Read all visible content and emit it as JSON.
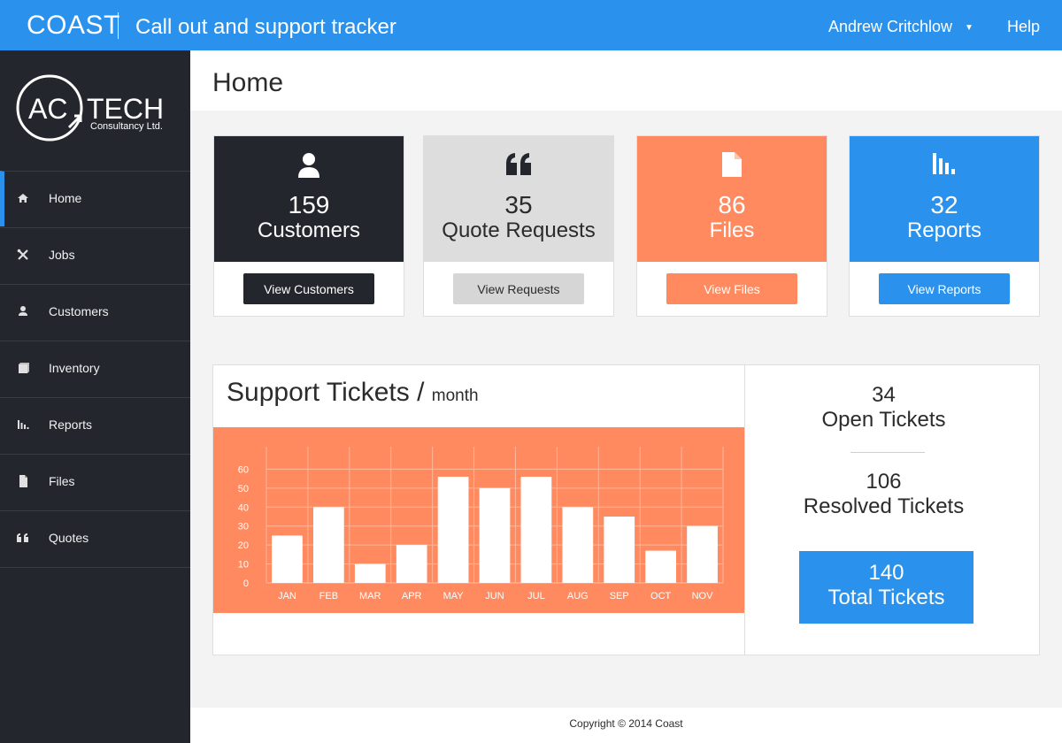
{
  "topbar": {
    "brand": "COAST",
    "tagline": "Call out and support tracker",
    "user_name": "Andrew Critchlow",
    "help_label": "Help"
  },
  "logo": {
    "line1": "AC",
    "line2": "TECH",
    "line3": "Consultancy Ltd."
  },
  "sidebar": {
    "items": [
      {
        "label": "Home",
        "icon": "home-icon"
      },
      {
        "label": "Jobs",
        "icon": "tools-icon"
      },
      {
        "label": "Customers",
        "icon": "user-icon"
      },
      {
        "label": "Inventory",
        "icon": "box-icon"
      },
      {
        "label": "Reports",
        "icon": "bar-chart-icon"
      },
      {
        "label": "Files",
        "icon": "file-icon"
      },
      {
        "label": "Quotes",
        "icon": "quote-icon"
      }
    ],
    "active_index": 0
  },
  "page": {
    "title": "Home"
  },
  "cards": [
    {
      "count": "159",
      "label": "Customers",
      "button": "View Customers",
      "color": "#24262d",
      "text_color": "#ffffff",
      "button_color": "#24262d",
      "button_text": "#ffffff",
      "icon": "user-icon"
    },
    {
      "count": "35",
      "label": "Quote Requests",
      "button": "View Requests",
      "color": "#dddddd",
      "text_color": "#2b2b2b",
      "button_color": "#d6d6d6",
      "button_text": "#2b2b2b",
      "icon": "quote-icon"
    },
    {
      "count": "86",
      "label": "Files",
      "button": "View Files",
      "color": "#ff8a5f",
      "text_color": "#ffffff",
      "button_color": "#ff8a5f",
      "button_text": "#ffffff",
      "icon": "file-icon"
    },
    {
      "count": "32",
      "label": "Reports",
      "button": "View Reports",
      "color": "#2a92ec",
      "text_color": "#ffffff",
      "button_color": "#2a92ec",
      "button_text": "#ffffff",
      "icon": "bar-chart-icon"
    }
  ],
  "tickets": {
    "title": "Support Tickets",
    "subtitle": "month",
    "open_count": "34",
    "open_label": "Open Tickets",
    "resolved_count": "106",
    "resolved_label": "Resolved Tickets",
    "total_count": "140",
    "total_label": "Total Tickets"
  },
  "chart_data": {
    "type": "bar",
    "categories": [
      "JAN",
      "FEB",
      "MAR",
      "APR",
      "MAY",
      "JUN",
      "JUL",
      "AUG",
      "SEP",
      "OCT",
      "NOV"
    ],
    "values": [
      25,
      40,
      10,
      20,
      56,
      50,
      56,
      40,
      35,
      17,
      30
    ],
    "ylim": [
      0,
      70
    ],
    "yticks": [
      0,
      10,
      20,
      30,
      40,
      50,
      60
    ],
    "grid": true,
    "background": "#ff8a5f",
    "bar_color": "#ffffff"
  },
  "footer": {
    "text": "Copyright © 2014 Coast"
  }
}
